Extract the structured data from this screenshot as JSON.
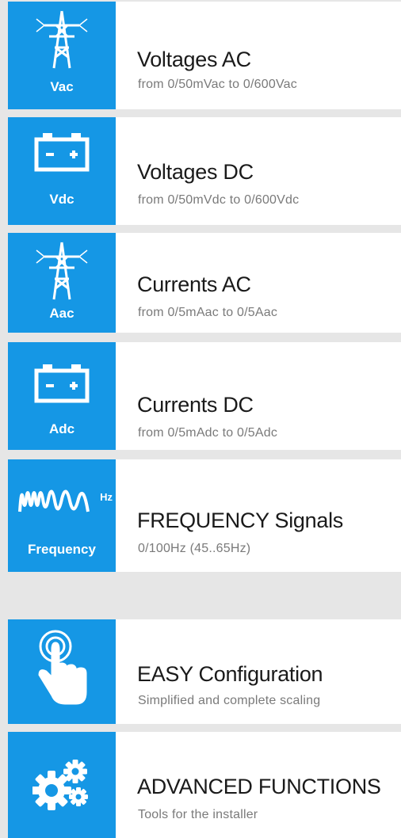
{
  "colors": {
    "accent": "#1597e5",
    "background": "#e6e6e6",
    "card": "#ffffff"
  },
  "items": [
    {
      "icon": "power-pylon-icon",
      "badge": "Vac",
      "title": "Voltages AC",
      "subtitle": "from 0/50mVac to 0/600Vac"
    },
    {
      "icon": "battery-icon",
      "badge": "Vdc",
      "title": "Voltages DC",
      "subtitle": "from 0/50mVdc to 0/600Vdc"
    },
    {
      "icon": "power-pylon-icon",
      "badge": "Aac",
      "title": "Currents AC",
      "subtitle": "from 0/5mAac to 0/5Aac"
    },
    {
      "icon": "battery-icon",
      "badge": "Adc",
      "title": "Currents DC",
      "subtitle": "from 0/5mAdc to 0/5Adc"
    },
    {
      "icon": "waveform-icon",
      "badge": "Frequency",
      "icon_text": "Hz",
      "title": "FREQUENCY Signals",
      "subtitle": "0/100Hz (45..65Hz)"
    }
  ],
  "features": [
    {
      "icon": "touch-hand-icon",
      "title": "EASY Configuration",
      "subtitle": "Simplified and complete scaling"
    },
    {
      "icon": "gears-icon",
      "title": "ADVANCED FUNCTIONS",
      "subtitle": "Tools for the installer"
    }
  ]
}
